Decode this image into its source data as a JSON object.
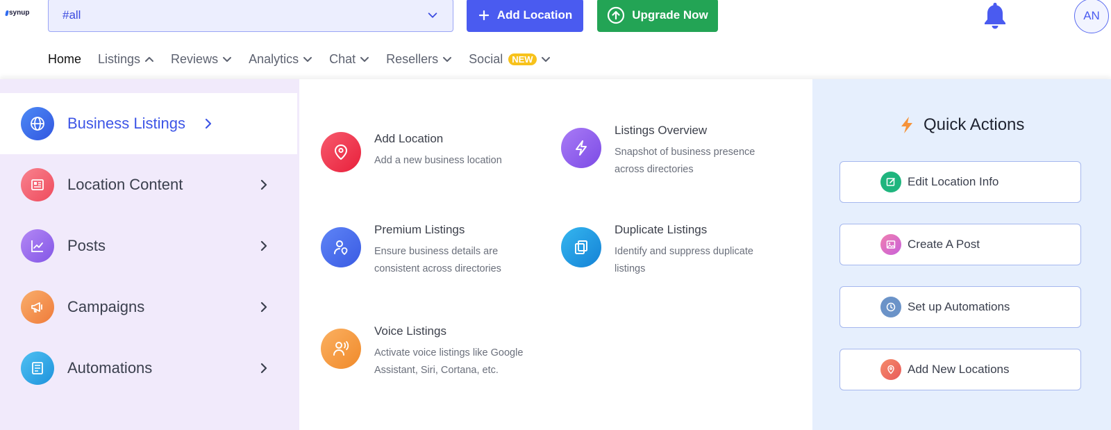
{
  "brand": {
    "logo_text": "synup"
  },
  "header": {
    "location_select_value": "#all",
    "add_location_label": "Add Location",
    "upgrade_label": "Upgrade Now",
    "avatar_initials": "AN"
  },
  "nav": {
    "items": [
      {
        "label": "Home"
      },
      {
        "label": "Listings"
      },
      {
        "label": "Reviews"
      },
      {
        "label": "Analytics"
      },
      {
        "label": "Chat"
      },
      {
        "label": "Resellers"
      },
      {
        "label": "Social"
      }
    ],
    "new_badge": "NEW"
  },
  "categories": [
    {
      "label": "Business Listings",
      "icon": "globe-icon"
    },
    {
      "label": "Location Content",
      "icon": "newspaper-icon"
    },
    {
      "label": "Posts",
      "icon": "chart-line-icon"
    },
    {
      "label": "Campaigns",
      "icon": "megaphone-icon"
    },
    {
      "label": "Automations",
      "icon": "document-icon"
    }
  ],
  "items": [
    {
      "title": "Add Location",
      "desc": "Add a new business location",
      "icon": "map-pin-icon"
    },
    {
      "title": "Listings Overview",
      "desc": "Snapshot of business presence across directories",
      "icon": "lightning-icon"
    },
    {
      "title": "Premium Listings",
      "desc": "Ensure business details are consistent across directories",
      "icon": "user-location-icon"
    },
    {
      "title": "Duplicate Listings",
      "desc": "Identify and suppress duplicate listings",
      "icon": "copy-icon"
    },
    {
      "title": "Voice Listings",
      "desc": "Activate voice listings like Google Assistant, Siri, Cortana, etc.",
      "icon": "voice-user-icon"
    }
  ],
  "quick_actions": {
    "title": "Quick Actions",
    "buttons": [
      {
        "label": "Edit Location Info",
        "icon": "edit-icon"
      },
      {
        "label": "Create A Post",
        "icon": "image-icon"
      },
      {
        "label": "Set up Automations",
        "icon": "clock-icon"
      },
      {
        "label": "Add New Locations",
        "icon": "map-pin-icon"
      }
    ]
  },
  "colors": {
    "primary": "#4a5bf0",
    "upgrade": "#23a455",
    "left_panel_bg": "#f1eafb",
    "right_panel_bg": "#e6effd"
  }
}
